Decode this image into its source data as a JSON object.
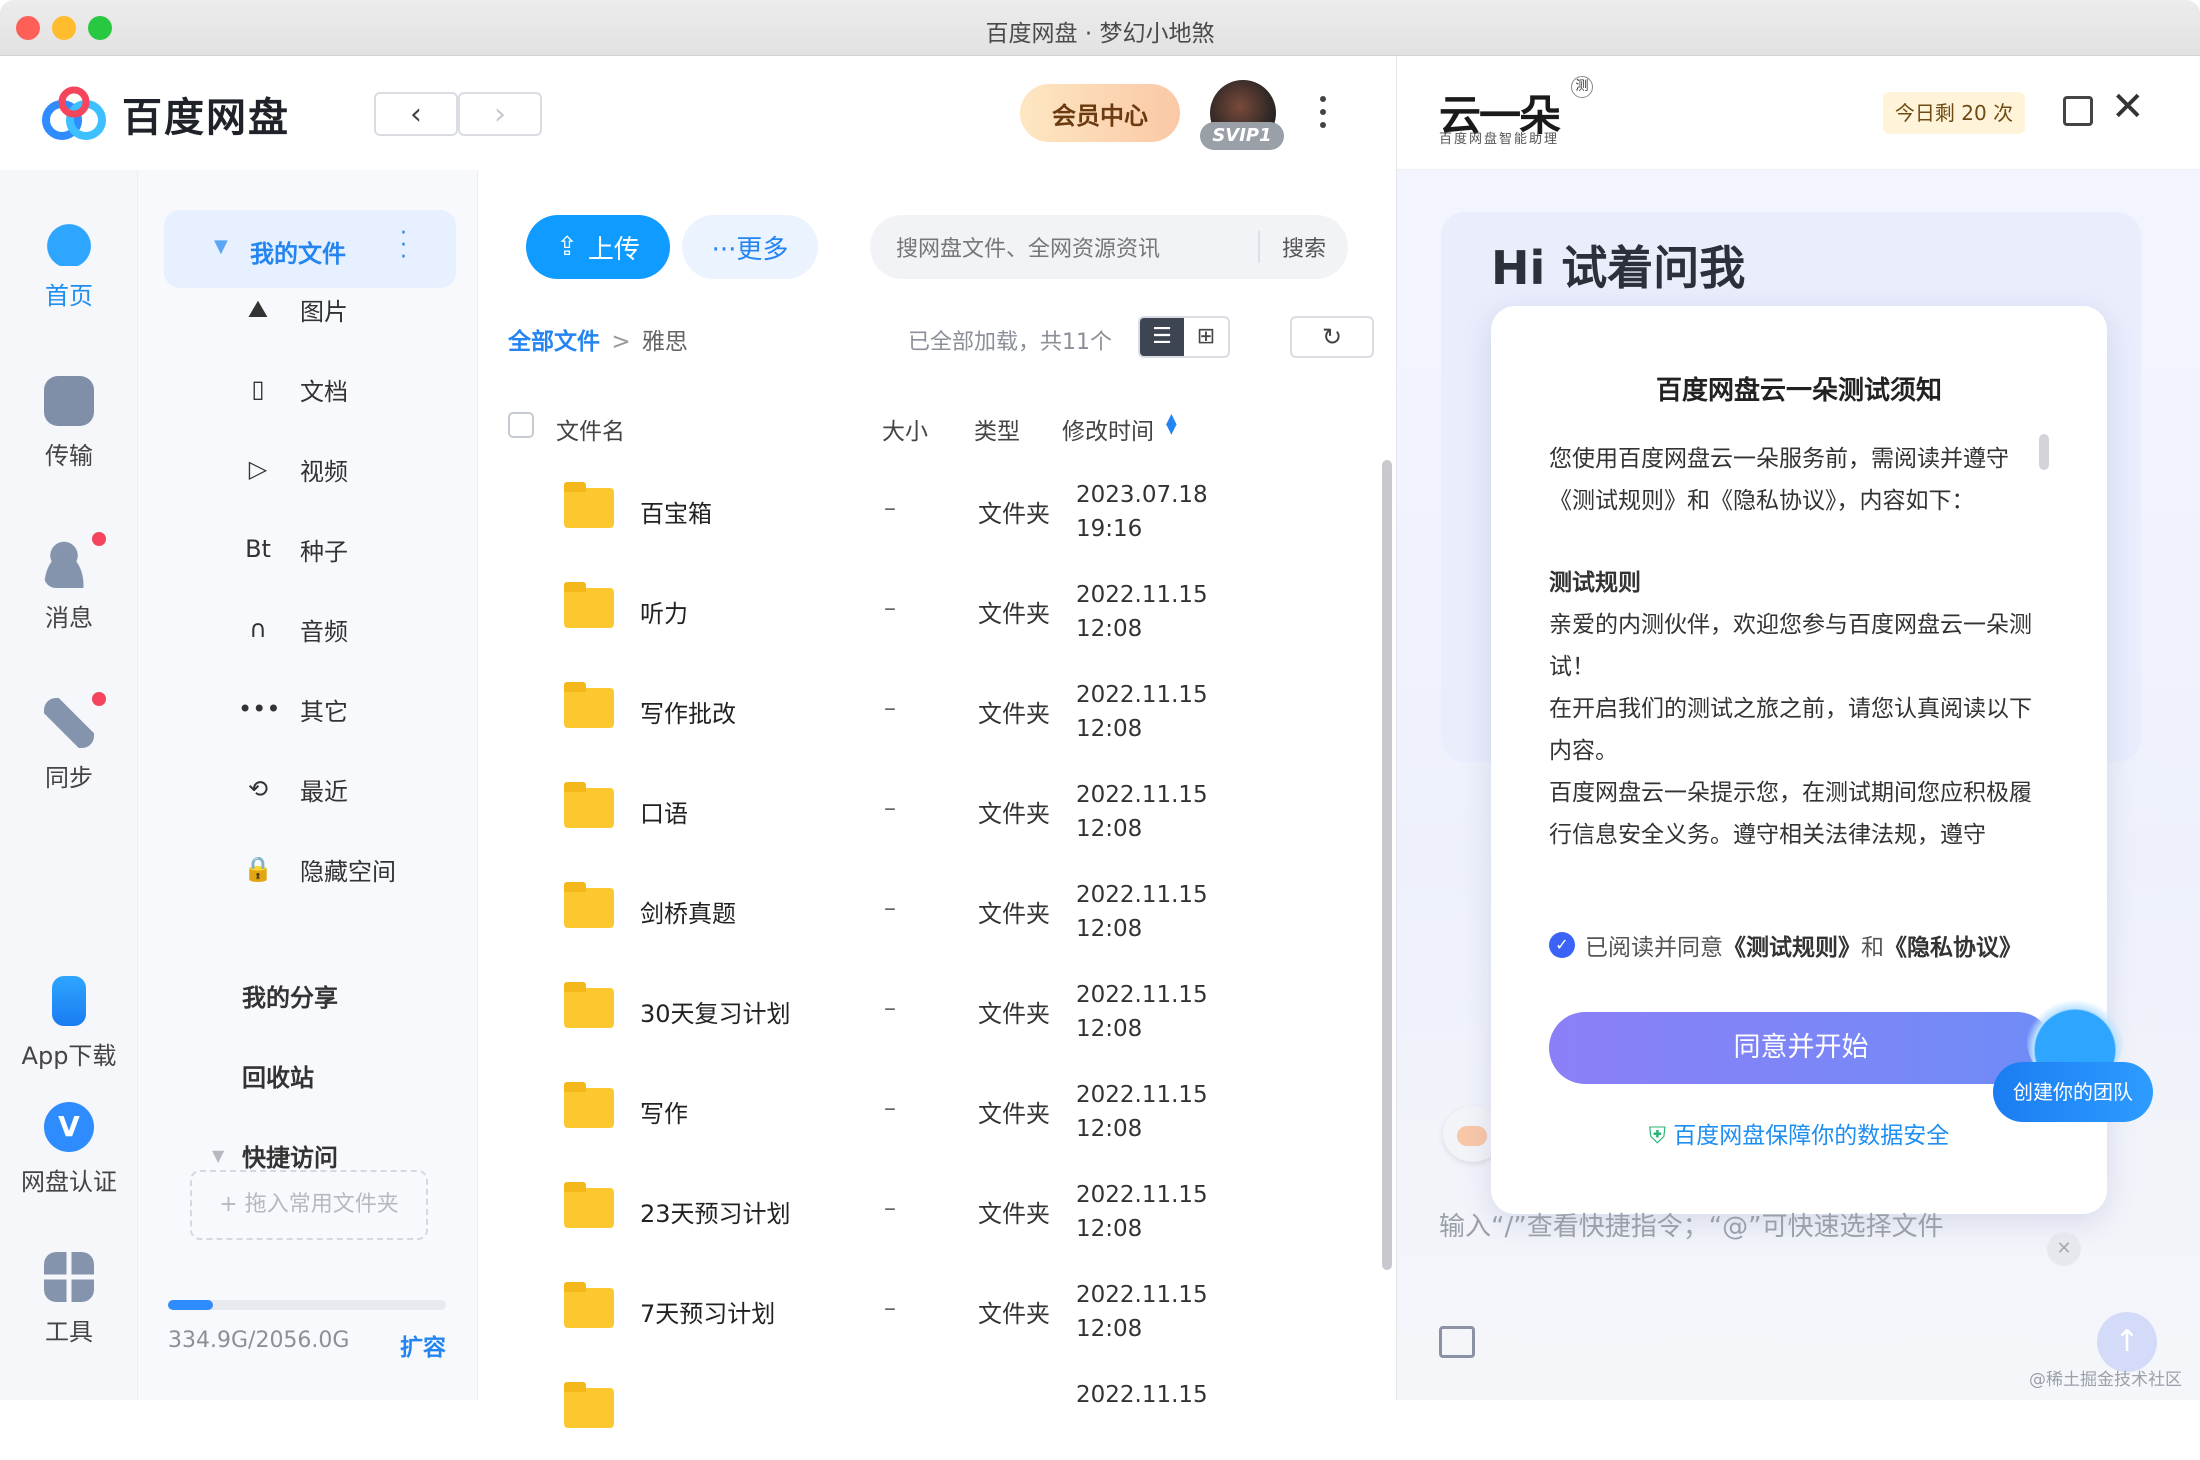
{
  "window": {
    "title": "百度网盘 · 梦幻小地煞"
  },
  "header": {
    "app_name": "百度网盘",
    "vip_label": "会员中心",
    "svip_badge": "SVIP1"
  },
  "rail": {
    "items": [
      {
        "label": "首页",
        "icon": "cloud-home-icon",
        "color": "#1f8ef1"
      },
      {
        "label": "传输",
        "icon": "transfer-icon",
        "color": "#444444"
      },
      {
        "label": "消息",
        "icon": "message-icon",
        "color": "#444444"
      },
      {
        "label": "同步",
        "icon": "sync-icon",
        "color": "#444444"
      },
      {
        "label": "App下载",
        "icon": "phone-icon",
        "color": "#444444"
      },
      {
        "label": "网盘认证",
        "icon": "verify-icon",
        "color": "#444444"
      },
      {
        "label": "工具",
        "icon": "tools-icon",
        "color": "#444444"
      }
    ]
  },
  "sidebar": {
    "my_files": "我的文件",
    "items": [
      {
        "label": "图片",
        "icon": "image-icon",
        "glyph": "⛰"
      },
      {
        "label": "文档",
        "icon": "document-icon",
        "glyph": "▯"
      },
      {
        "label": "视频",
        "icon": "video-icon",
        "glyph": "▷"
      },
      {
        "label": "种子",
        "icon": "bt-icon",
        "glyph": "Bt"
      },
      {
        "label": "音频",
        "icon": "headphones-icon",
        "glyph": "∩"
      },
      {
        "label": "其它",
        "icon": "more-icon",
        "glyph": "•••"
      },
      {
        "label": "最近",
        "icon": "history-icon",
        "glyph": "⟲"
      },
      {
        "label": "隐藏空间",
        "icon": "lock-icon",
        "glyph": "🔒"
      }
    ],
    "my_share": "我的分享",
    "recycle": "回收站",
    "quick_access": "快捷访问",
    "drop_placeholder": "+ 拖入常用文件夹",
    "quota_text": "334.9G/2056.0G",
    "quota_fraction": 0.163,
    "expand": "扩容"
  },
  "toolbar": {
    "upload": "上传",
    "more": "···更多",
    "search_placeholder": "搜网盘文件、全网资源资讯",
    "search_button": "搜索"
  },
  "breadcrumb": {
    "root": "全部文件",
    "separator": ">",
    "current": "雅思"
  },
  "status": {
    "loaded": "已全部加载，共11个"
  },
  "table": {
    "headers": {
      "name": "文件名",
      "size": "大小",
      "type": "类型",
      "mtime": "修改时间"
    },
    "rows": [
      {
        "name": "百宝箱",
        "size": "–",
        "type": "文件夹",
        "date": "2023.07.18",
        "time": "19:16"
      },
      {
        "name": "听力",
        "size": "–",
        "type": "文件夹",
        "date": "2022.11.15",
        "time": "12:08"
      },
      {
        "name": "写作批改",
        "size": "–",
        "type": "文件夹",
        "date": "2022.11.15",
        "time": "12:08"
      },
      {
        "name": "口语",
        "size": "–",
        "type": "文件夹",
        "date": "2022.11.15",
        "time": "12:08"
      },
      {
        "name": "剑桥真题",
        "size": "–",
        "type": "文件夹",
        "date": "2022.11.15",
        "time": "12:08"
      },
      {
        "name": "30天复习计划",
        "size": "–",
        "type": "文件夹",
        "date": "2022.11.15",
        "time": "12:08"
      },
      {
        "name": "写作",
        "size": "–",
        "type": "文件夹",
        "date": "2022.11.15",
        "time": "12:08"
      },
      {
        "name": "23天预习计划",
        "size": "–",
        "type": "文件夹",
        "date": "2022.11.15",
        "time": "12:08"
      },
      {
        "name": "7天预习计划",
        "size": "–",
        "type": "文件夹",
        "date": "2022.11.15",
        "time": "12:08"
      },
      {
        "name": "",
        "size": "",
        "type": "",
        "date": "2022.11.15",
        "time": ""
      }
    ]
  },
  "assistant": {
    "brand": "云一朵",
    "brand_badge": "测",
    "brand_sub": "百度网盘智能助理",
    "quota": "今日剩 20 次",
    "greeting": "Hi 试着问我",
    "modal": {
      "title": "百度网盘云一朵测试须知",
      "intro": "您使用百度网盘云一朵服务前，需阅读并遵守《测试规则》和《隐私协议》，内容如下：",
      "section_title": "测试规则",
      "p1": "亲爱的内测伙伴，欢迎您参与百度网盘云一朵测试！",
      "p2": "在开启我们的测试之旅之前，请您认真阅读以下内容。",
      "p3": "百度网盘云一朵提示您，在测试期间您应积极履行信息安全义务。遵守相关法律法规，遵守",
      "agree_prefix": "已阅读并同意",
      "rules_link": "《测试规则》",
      "and": "和",
      "privacy_link": "《隐私协议》",
      "start_button": "同意并开始",
      "safety": "百度网盘保障你的数据安全"
    },
    "team_button": "创建你的团队",
    "input_placeholder": "输入“/”查看快捷指令；“@”可快速选择文件"
  },
  "watermark": "@稀土掘金技术社区"
}
